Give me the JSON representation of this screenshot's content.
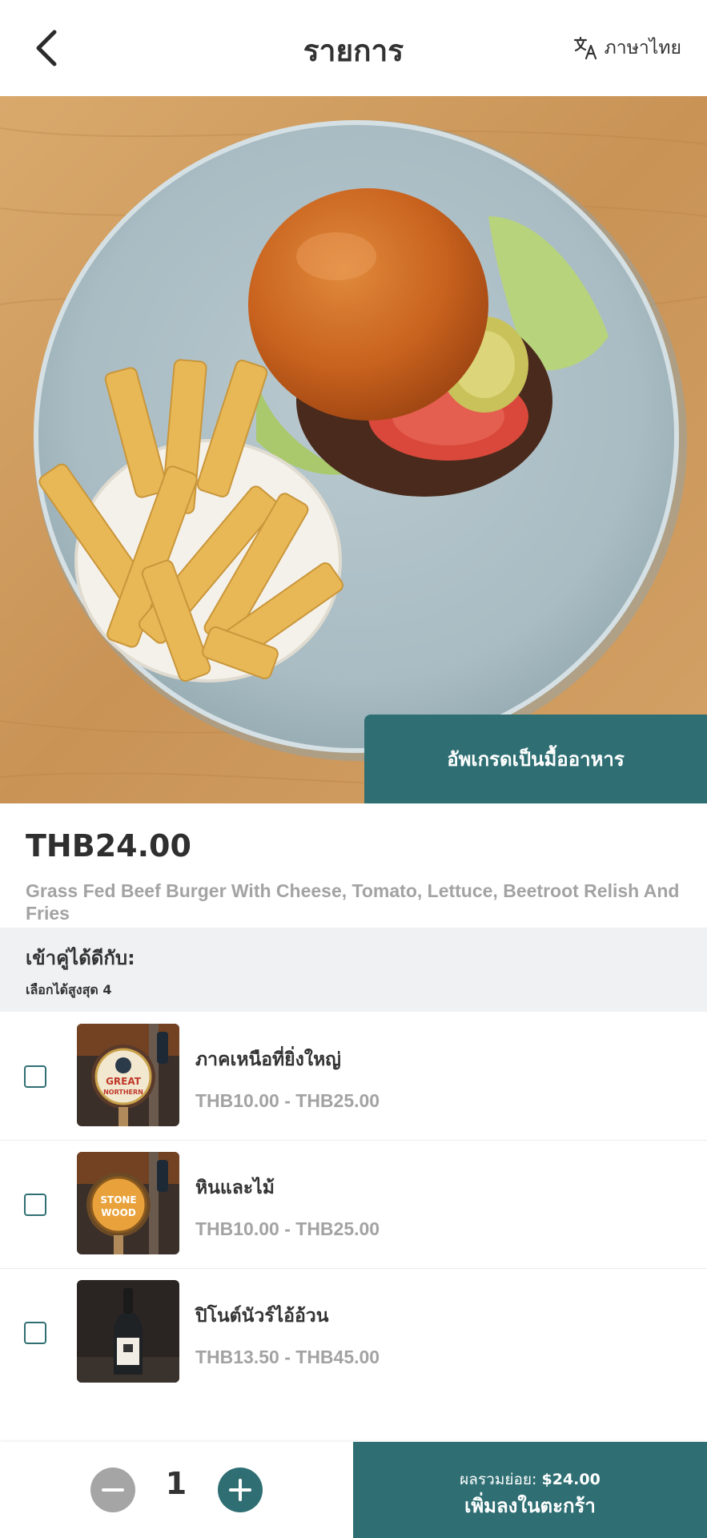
{
  "header": {
    "title": "รายการ",
    "language_label": "ภาษาไทย"
  },
  "hero": {
    "upgrade_label": "อัพเกรดเป็นมื้ออาหาร"
  },
  "product": {
    "price": "THB24.00",
    "description": "Grass Fed Beef Burger With Cheese, Tomato, Lettuce, Beetroot Relish And Fries"
  },
  "pairing": {
    "title": "เข้าคู่ได้ดีกับ:",
    "subtitle": "เลือกได้สูงสุด 4",
    "items": [
      {
        "name": "ภาคเหนือที่ยิ่งใหญ่",
        "price": "THB10.00 - THB25.00",
        "checked": false,
        "badge_top": "GREAT",
        "badge_bottom": "NORTHERN"
      },
      {
        "name": "หินและไม้",
        "price": "THB10.00 - THB25.00",
        "checked": false,
        "badge_top": "STONE",
        "badge_bottom": "WOOD"
      },
      {
        "name": "ปิโนต์นัวร์ไอ้อ้วน",
        "price": "THB13.50 - THB45.00",
        "checked": false
      }
    ]
  },
  "bottom": {
    "quantity": "1",
    "subtotal_label": "ผลรวมย่อย:",
    "subtotal_value": "$24.00",
    "cart_label": "เพิ่มลงในตะกร้า"
  },
  "colors": {
    "accent": "#2f6f73",
    "muted": "#a3a3a3",
    "minus_button": "#a5a5a5"
  }
}
